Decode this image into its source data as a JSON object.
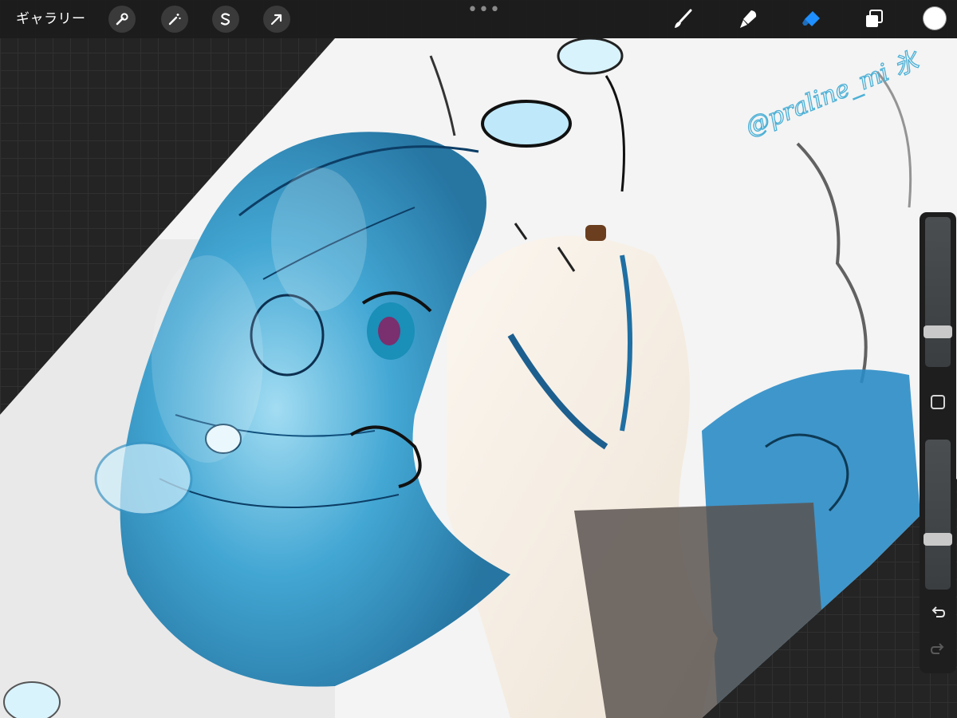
{
  "toolbar": {
    "gallery_label": "ギャラリー",
    "more_label": "•••"
  },
  "artwork": {
    "signature_text": "@praline_mi 氷"
  },
  "colors": {
    "accent": "#1f8fff",
    "hair": "#2a8fc0",
    "skin": "#f3ece2",
    "background": "#242424",
    "current_color": "#ffffff"
  },
  "icons": {
    "adjust": "wrench-icon",
    "magic": "magic-wand-icon",
    "selection": "selection-s-icon",
    "transform": "arrow-cursor-icon",
    "brush": "brush-icon",
    "smudge": "smudge-icon",
    "eraser": "eraser-icon",
    "layers": "layers-icon",
    "undo": "undo-icon",
    "redo": "redo-icon"
  }
}
